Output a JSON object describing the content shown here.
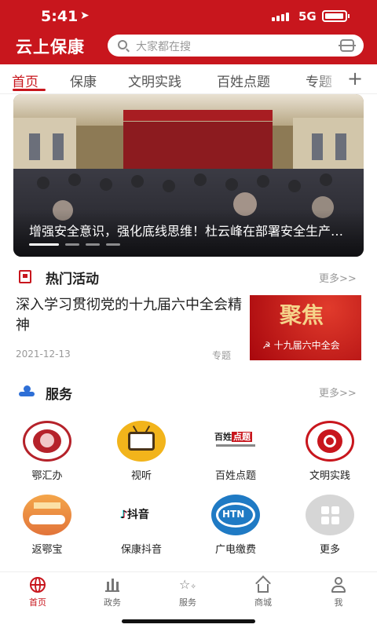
{
  "status_bar": {
    "time": "5:41",
    "network": "5G"
  },
  "header": {
    "app_title": "云上保康",
    "search_placeholder": "大家都在搜"
  },
  "tabs": [
    "首页",
    "保康",
    "文明实践",
    "百姓点题",
    "专题"
  ],
  "active_tab": "首页",
  "banner": {
    "caption": "增强安全意识，强化底线思维！杜云峰在部署安全生产工作",
    "slide_count": 4,
    "active_slide": 1
  },
  "hot_section": {
    "title": "热门活动",
    "more_label": "更多>>",
    "article": {
      "title": "深入学习贯彻党的十九届六中全会精神",
      "date": "2021-12-13",
      "tag": "专题",
      "thumb_big": "聚焦",
      "thumb_small": "☭ 十九届六中全会"
    }
  },
  "service_section": {
    "title": "服务",
    "more_label": "更多>>",
    "items": [
      {
        "label": "鄂汇办",
        "icon": "ehuiban-icon"
      },
      {
        "label": "视听",
        "icon": "tv-icon"
      },
      {
        "label": "百姓点题",
        "icon": "baixing-dianti-icon"
      },
      {
        "label": "文明实践",
        "icon": "wenming-shijian-icon"
      },
      {
        "label": "返鄂宝",
        "icon": "fanebao-icon"
      },
      {
        "label": "保康抖音",
        "icon": "douyin-icon"
      },
      {
        "label": "广电缴费",
        "icon": "guangdian-icon"
      },
      {
        "label": "更多",
        "icon": "grid-more-icon"
      }
    ]
  },
  "bottom_nav": [
    {
      "label": "首页",
      "icon": "globe-icon",
      "active": true
    },
    {
      "label": "政务",
      "icon": "building-icon",
      "active": false
    },
    {
      "label": "服务",
      "icon": "service-stars-icon",
      "active": false
    },
    {
      "label": "商城",
      "icon": "shop-house-icon",
      "active": false
    },
    {
      "label": "我",
      "icon": "user-icon",
      "active": false
    }
  ],
  "colors": {
    "brand_red": "#c8161d",
    "service_blue": "#2e6fd6"
  }
}
